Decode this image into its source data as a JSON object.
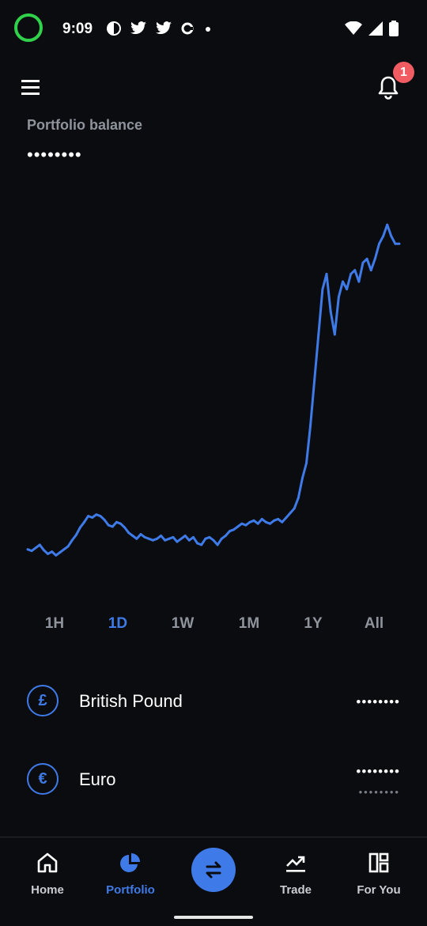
{
  "status_bar": {
    "time": "9:09",
    "icons": [
      "moon-icon",
      "twitter-icon",
      "twitter-icon",
      "sync-icon",
      "dot-icon"
    ],
    "right_icons": [
      "wifi-icon",
      "signal-icon",
      "battery-icon"
    ]
  },
  "header": {
    "notification_count": "1",
    "balance_label": "Portfolio balance",
    "balance_value": "••••••••"
  },
  "chart_data": {
    "type": "line",
    "title": "",
    "xlabel": "",
    "ylabel": "",
    "color": "#3f7be8",
    "y": [
      16,
      14,
      18,
      22,
      15,
      10,
      13,
      8,
      12,
      16,
      20,
      28,
      35,
      45,
      52,
      60,
      58,
      62,
      60,
      55,
      48,
      46,
      52,
      50,
      45,
      38,
      34,
      30,
      36,
      32,
      30,
      28,
      30,
      34,
      28,
      30,
      32,
      26,
      30,
      34,
      28,
      32,
      24,
      22,
      30,
      32,
      28,
      22,
      30,
      34,
      40,
      42,
      46,
      50,
      48,
      52,
      54,
      50,
      56,
      52,
      50,
      54,
      56,
      52,
      58,
      64,
      70,
      84,
      110,
      130,
      180,
      240,
      300,
      360,
      380,
      330,
      300,
      350,
      370,
      360,
      380,
      385,
      370,
      395,
      400,
      385,
      400,
      420,
      430,
      445,
      430,
      420,
      420
    ],
    "ylim": [
      0,
      460
    ]
  },
  "ranges": {
    "items": [
      "1H",
      "1D",
      "1W",
      "1M",
      "1Y",
      "All"
    ],
    "active": "1D"
  },
  "assets": [
    {
      "symbol": "£",
      "name": "British Pound",
      "value": "••••••••",
      "sub": ""
    },
    {
      "symbol": "€",
      "name": "Euro",
      "value": "••••••••",
      "sub": "••••••••"
    }
  ],
  "nav": {
    "home": "Home",
    "portfolio": "Portfolio",
    "trade": "Trade",
    "for_you": "For You",
    "active": "Portfolio"
  }
}
